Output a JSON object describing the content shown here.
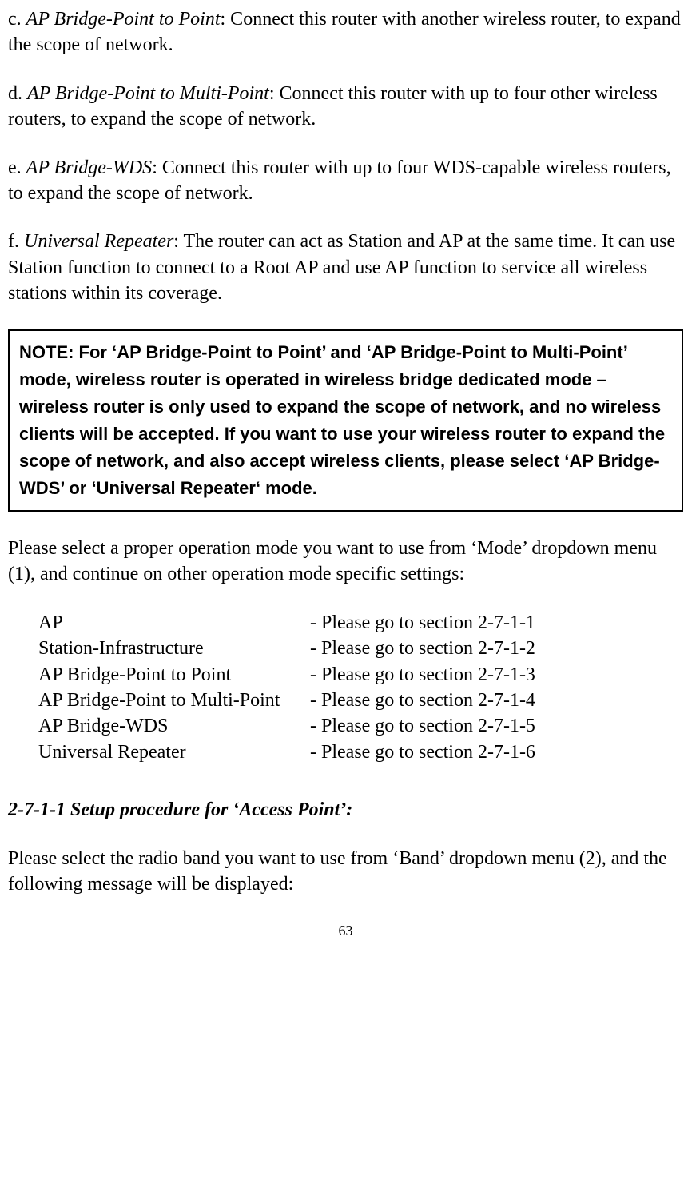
{
  "p_c": {
    "prefix": "c. ",
    "title": "AP Bridge-Point to Point",
    "desc": ": Connect this router with another wireless router, to expand the scope of network."
  },
  "p_d": {
    "prefix": "d. ",
    "title": "AP Bridge-Point to Multi-Point",
    "desc": ": Connect this router with up to four other wireless routers, to expand the scope of network."
  },
  "p_e": {
    "prefix": "e. ",
    "title": "AP Bridge-WDS",
    "desc": ": Connect this router with up to four WDS-capable wireless routers, to expand the scope of network."
  },
  "p_f": {
    "prefix": "f. ",
    "title": "Universal Repeater",
    "desc": ": The router can act as Station and AP at the same time. It can use Station function to connect to a Root AP and use AP function to service all wireless stations within its coverage."
  },
  "note": "NOTE: For ‘AP Bridge-Point to Point’ and ‘AP Bridge-Point to Multi-Point’ mode, wireless router is operated in wireless bridge dedicated mode – wireless router is only used to expand the scope of network, and no wireless clients will be accepted. If you want to use your wireless router to expand the scope of network, and also accept wireless clients, please select ‘AP Bridge-WDS’ or ‘Universal Repeater‘ mode.",
  "after_note": "Please select a proper operation mode you want to use from ‘Mode’ dropdown menu (1), and continue on other operation mode specific settings:",
  "modes": [
    {
      "label": "AP",
      "section": "- Please go to section 2-7-1-1"
    },
    {
      "label": "Station-Infrastructure",
      "section": "- Please go to section 2-7-1-2"
    },
    {
      "label": "AP Bridge-Point to Point",
      "section": "- Please go to section 2-7-1-3"
    },
    {
      "label": "AP Bridge-Point to Multi-Point",
      "section": "- Please go to section 2-7-1-4"
    },
    {
      "label": "AP Bridge-WDS",
      "section": "- Please go to section 2-7-1-5"
    },
    {
      "label": "Universal Repeater",
      "section": "- Please go to section 2-7-1-6"
    }
  ],
  "heading": "2-7-1-1 Setup procedure for ‘Access Point’:",
  "band_para": "Please select the radio band you want to use from ‘Band’ dropdown menu (2), and the following message will be displayed:",
  "page_number": "63"
}
